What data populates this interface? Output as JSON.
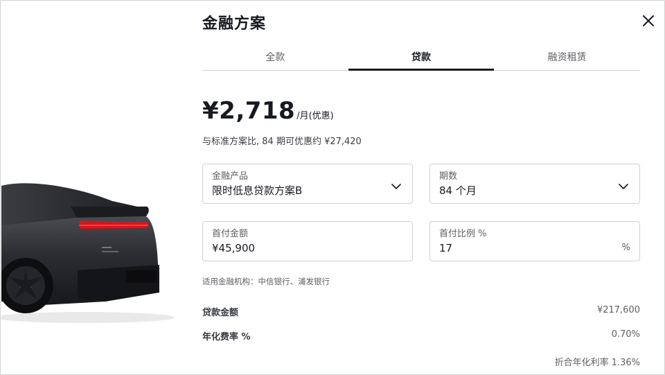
{
  "modal": {
    "title": "金融方案",
    "close_icon": "close-icon"
  },
  "tabs": [
    {
      "label": "全款",
      "active": false
    },
    {
      "label": "贷款",
      "active": true
    },
    {
      "label": "融资租赁",
      "active": false
    }
  ],
  "summary": {
    "monthly_price": "¥2,718",
    "price_suffix": "/月(优惠)",
    "comparison": "与标准方案比, 84 期可优惠约 ¥27,420"
  },
  "fields": {
    "product": {
      "label": "金融产品",
      "value": "限时低息贷款方案B"
    },
    "term": {
      "label": "期数",
      "value": "84 个月"
    },
    "down_payment": {
      "label": "首付金额",
      "value": "¥45,900"
    },
    "down_ratio": {
      "label": "首付比例 %",
      "value": "17",
      "unit": "%"
    }
  },
  "banks_note": "适用金融机构：中信银行、浦发银行",
  "details": {
    "loan_amount_label": "贷款金额",
    "loan_amount_value": "¥217,600",
    "rate_label": "年化费率 %",
    "rate_value": "0.70%",
    "apr_note": "折合年化利率 1.36%"
  },
  "colors": {
    "text_primary": "#171a20",
    "text_secondary": "#5c5e62",
    "border": "#d0d1d2",
    "taillight": "#d8141c",
    "car_body": "#2a2b30"
  }
}
